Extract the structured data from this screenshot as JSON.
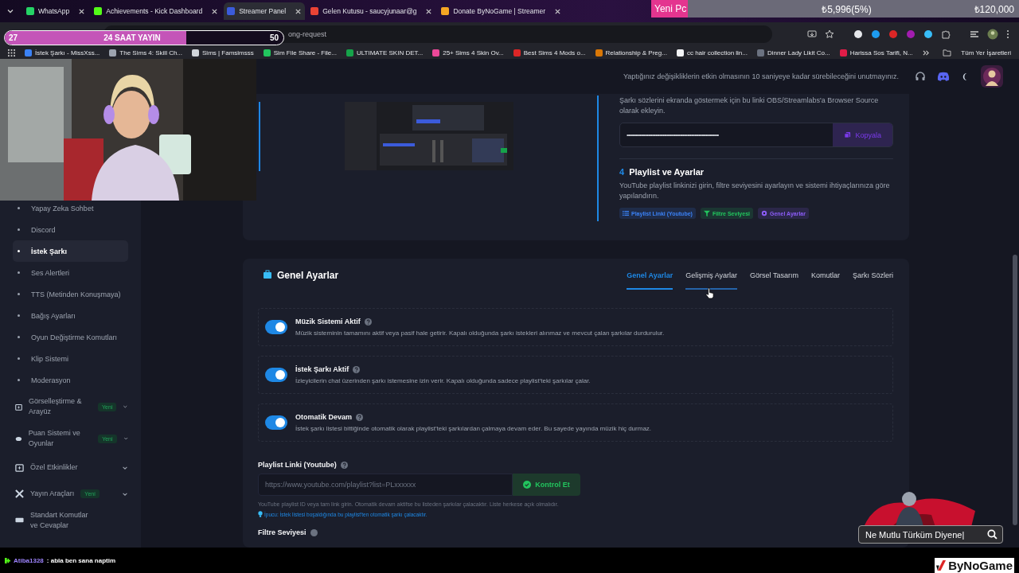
{
  "browser_tabs": [
    {
      "label": "WhatsApp",
      "selected": false,
      "color": "#25d366"
    },
    {
      "label": "Achievements - Kick Dashboard",
      "selected": false,
      "color": "#53fc18"
    },
    {
      "label": "Streamer Panel",
      "selected": true,
      "color": "#3b5bdb"
    },
    {
      "label": "Gelen Kutusu - saucyjunaar@g",
      "selected": false,
      "color": "#ea4335"
    },
    {
      "label": "Donate ByNoGame | Streamer",
      "selected": false,
      "color": "#f5a623"
    }
  ],
  "address_bar": {
    "value": "ong-request"
  },
  "bookmarks": [
    {
      "label": "İstek Şarkı - MissXss...",
      "color": "#3b82f6"
    },
    {
      "label": "The Sims 4: Skill Ch...",
      "color": "#9ca3af"
    },
    {
      "label": "Sims | Famsimsss",
      "color": "#d1d5db"
    },
    {
      "label": "Sim File Share - File...",
      "color": "#22c55e"
    },
    {
      "label": "ULTIMATE SKIN DET...",
      "color": "#16a34a"
    },
    {
      "label": "25+ Sims 4 Skin Ov...",
      "color": "#ec4899"
    },
    {
      "label": "Best Sims 4 Mods o...",
      "color": "#dc2626"
    },
    {
      "label": "Relationship & Preg...",
      "color": "#d97706"
    },
    {
      "label": "cc hair collection lin...",
      "color": "#f3f4f6"
    },
    {
      "label": "Dinner Lady Likit Co...",
      "color": "#6b7280"
    },
    {
      "label": "Harissa Sos Tarifi, N...",
      "color": "#e11d48"
    }
  ],
  "bookmarks_folder": "Tüm Yer İşaretleri",
  "stream_overlay": {
    "goal": {
      "title": "Yeni Pc",
      "amount": "₺5,996(5%)",
      "target": "₺120,000",
      "level": 0.1
    },
    "timer": {
      "start": "27",
      "title": "24 SAAT YAYIN",
      "end": "50",
      "level": 0.65
    }
  },
  "notice": "Yaptığınız değişikliklerin etkin olmasının 10 saniyeye kadar sürebileceğini unutmayınız.",
  "sidebar": {
    "items": [
      {
        "kind": "sub",
        "label": "Yapay Zeka Sohbet",
        "selected": false
      },
      {
        "kind": "sub",
        "label": "Discord",
        "selected": false
      },
      {
        "kind": "sub",
        "label": "İstek Şarkı",
        "selected": true
      },
      {
        "kind": "sub",
        "label": "Ses Alertleri",
        "selected": false
      },
      {
        "kind": "sub",
        "label": "TTS (Metinden Konuşmaya)",
        "selected": false
      },
      {
        "kind": "sub",
        "label": "Bağış Ayarları",
        "selected": false
      },
      {
        "kind": "sub",
        "label": "Oyun Değiştirme Komutları",
        "selected": false
      },
      {
        "kind": "sub",
        "label": "Klip Sistemi",
        "selected": false
      },
      {
        "kind": "sub",
        "label": "Moderasyon",
        "selected": false
      },
      {
        "kind": "group",
        "label": "Görselleştirme & Arayüz",
        "badge": "Yeni"
      },
      {
        "kind": "group",
        "label": "Puan Sistemi ve Oyunlar",
        "badge": "Yeni"
      },
      {
        "kind": "group",
        "label": "Özel Etkinlikler"
      },
      {
        "kind": "group",
        "label": "Yayın Araçları",
        "badge": "Yeni"
      },
      {
        "kind": "plain",
        "label": "Standart Komutlar ve Cevaplar"
      }
    ]
  },
  "obs_link": {
    "intro": "Şarkı sözlerini ekranda göstermek için bu linki OBS/Streamlabs'a Browser Source olarak ekleyin.",
    "masked": "••••••••••••••••••••••••••••••••••••••••••••••••••••••••••••••••",
    "button": "Kopyala"
  },
  "step": {
    "number": "4",
    "title": "Playlist ve Ayarlar",
    "text": "YouTube playlist linkinizi girin, filtre seviyesini ayarlayın ve sistemi ihtiyaçlarınıza göre yapılandırın.",
    "tags": [
      {
        "label": "Playlist Linki (Youtube)",
        "color": "#3b82f6"
      },
      {
        "label": "Filtre Seviyesi",
        "color": "#22c55e"
      },
      {
        "label": "Genel Ayarlar",
        "color": "#8b5cf6"
      }
    ]
  },
  "settings": {
    "title": "Genel Ayarlar",
    "tabs": [
      {
        "label": "Genel Ayarlar",
        "selected": true,
        "hovered": false
      },
      {
        "label": "Gelişmiş Ayarlar",
        "selected": false,
        "hovered": true
      },
      {
        "label": "Görsel Tasarım",
        "selected": false,
        "hovered": false
      },
      {
        "label": "Komutlar",
        "selected": false,
        "hovered": false
      },
      {
        "label": "Şarkı Sözleri",
        "selected": false,
        "hovered": false
      }
    ],
    "toggles": [
      {
        "label": "Müzik Sistemi Aktif",
        "description": "Müzik sisteminin tamamını aktif veya pasif hale getirir. Kapalı olduğunda şarkı istekleri alınmaz ve mevcut çalan şarkılar durdurulur.",
        "on": true
      },
      {
        "label": "İstek Şarkı Aktif",
        "description": "İzleyicilerin chat üzerinden şarkı istemesine izin verir. Kapalı olduğunda sadece playlist'teki şarkılar çalar.",
        "on": true
      },
      {
        "label": "Otomatik Devam",
        "description": "İstek şarkı listesi bittiğinde otomatik olarak playlist'teki şarkılardan çalmaya devam eder. Bu sayede yayında müzik hiç durmaz.",
        "on": true
      }
    ],
    "playlist": {
      "label": "Playlist Linki (Youtube)",
      "placeholder": "https://www.youtube.com/playlist?list=PLxxxxxx",
      "button": "Kontrol Et",
      "help": "YouTube playlist ID veya tam link girin. Otomatik devam aktifse bu listeden şarkılar çalacaktır. Liste herkese açık olmalıdır.",
      "tip": "İpucu: İstek listesi boşaldığında bu playlist'ten otomatik şarkı çalacaktır."
    },
    "next_label": "Filtre Seviyesi"
  },
  "chat": {
    "user": "Atiba1328",
    "message": ": abla ben sana naptim"
  },
  "lower_overlay": {
    "search_text": "Ne Mutlu Türküm Diyene|"
  },
  "brand": "ByNoGame"
}
